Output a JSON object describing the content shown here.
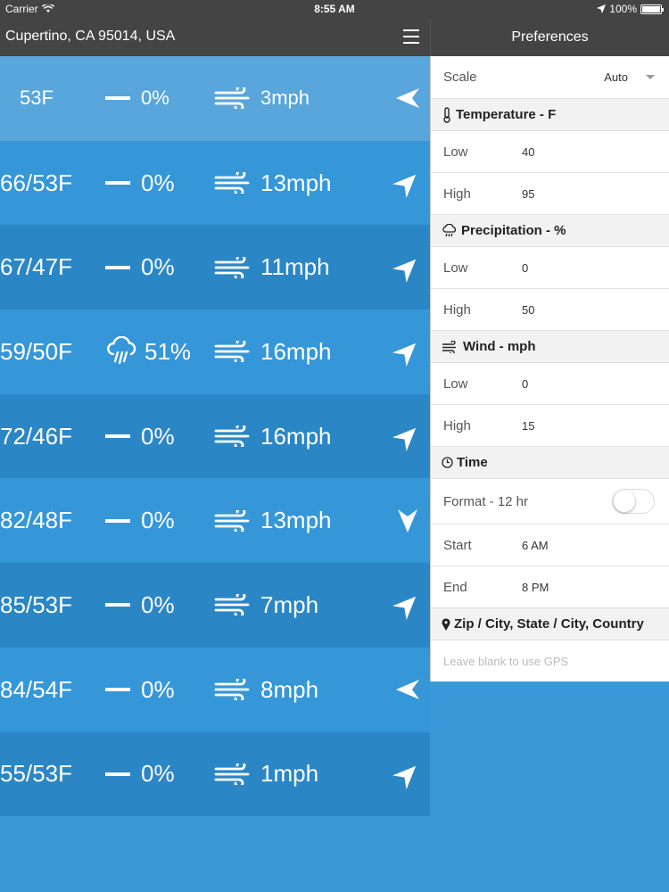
{
  "status_bar": {
    "carrier": "Carrier",
    "time": "8:55 AM",
    "battery": "100%",
    "battery_level": 1.0
  },
  "header": {
    "location": "Cupertino, CA 95014, USA",
    "menu_icon": "hamburger-icon"
  },
  "preferences": {
    "title": "Preferences",
    "scale": {
      "label": "Scale",
      "value": "Auto"
    },
    "temperature": {
      "title": "Temperature - F",
      "low_label": "Low",
      "low": "40",
      "high_label": "High",
      "high": "95"
    },
    "precipitation": {
      "title": "Precipitation - %",
      "low_label": "Low",
      "low": "0",
      "high_label": "High",
      "high": "50"
    },
    "wind": {
      "title": "Wind - mph",
      "low_label": "Low",
      "low": "0",
      "high_label": "High",
      "high": "15"
    },
    "time": {
      "title": "Time",
      "format_label": "Format - 12 hr",
      "format_on": false,
      "start_label": "Start",
      "start": "6 AM",
      "end_label": "End",
      "end": "8 PM"
    },
    "location": {
      "title": "Zip / City, State / City, Country",
      "placeholder": "Leave blank to use GPS"
    }
  },
  "forecast": [
    {
      "temp": "53F",
      "precip": "0%",
      "precip_icon": "dash",
      "wind": "3mph",
      "direction": "west",
      "color": "#58a6dc"
    },
    {
      "temp": "66/53F",
      "precip": "0%",
      "precip_icon": "dash",
      "wind": "13mph",
      "direction": "north-east",
      "color": "#3597d8"
    },
    {
      "temp": "67/47F",
      "precip": "0%",
      "precip_icon": "dash",
      "wind": "11mph",
      "direction": "north-east",
      "color": "#2b86c6"
    },
    {
      "temp": "59/50F",
      "precip": "51%",
      "precip_icon": "rain",
      "wind": "16mph",
      "direction": "north-east",
      "color": "#3597d8"
    },
    {
      "temp": "72/46F",
      "precip": "0%",
      "precip_icon": "dash",
      "wind": "16mph",
      "direction": "north-east",
      "color": "#2b86c6"
    },
    {
      "temp": "82/48F",
      "precip": "0%",
      "precip_icon": "dash",
      "wind": "13mph",
      "direction": "south",
      "color": "#3597d8"
    },
    {
      "temp": "85/53F",
      "precip": "0%",
      "precip_icon": "dash",
      "wind": "7mph",
      "direction": "north-east",
      "color": "#2b86c6"
    },
    {
      "temp": "84/54F",
      "precip": "0%",
      "precip_icon": "dash",
      "wind": "8mph",
      "direction": "west",
      "color": "#3597d8"
    },
    {
      "temp": "55/53F",
      "precip": "0%",
      "precip_icon": "dash",
      "wind": "1mph",
      "direction": "north-east",
      "color": "#2b86c6"
    }
  ]
}
